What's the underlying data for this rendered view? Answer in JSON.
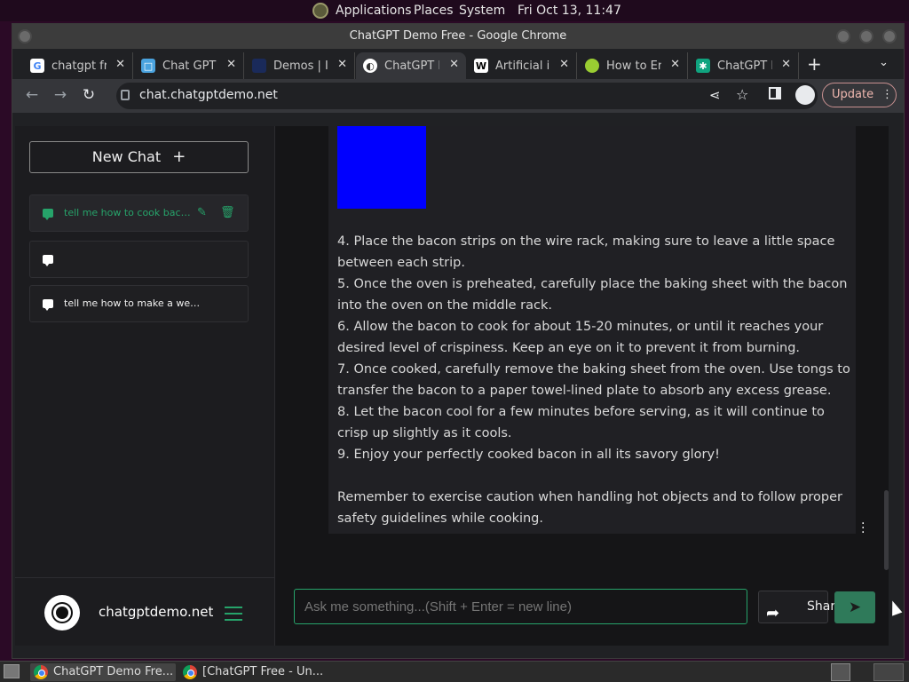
{
  "desktop": {
    "menu": [
      "Applications",
      "Places",
      "System"
    ],
    "clock": "Fri Oct 13, 11:47"
  },
  "window": {
    "title": "ChatGPT Demo Free - Google Chrome"
  },
  "tabs": [
    {
      "label": "chatgpt fre",
      "icon": "google-icon",
      "color": "#ffffff"
    },
    {
      "label": "Chat GPT C",
      "icon": "chat-icon",
      "color": "#4aa3df"
    },
    {
      "label": "Demos | In",
      "icon": "demos-icon",
      "color": "#1a2a5a"
    },
    {
      "label": "ChatGPT D",
      "icon": "chatgptdemo-icon",
      "color": "#ffffff"
    },
    {
      "label": "Artificial i",
      "icon": "wikipedia-icon",
      "color": "#ffffff"
    },
    {
      "label": "How to En",
      "icon": "howto-icon",
      "color": "#9acd32"
    },
    {
      "label": "ChatGPT F",
      "icon": "openai-icon",
      "color": "#10a37f"
    }
  ],
  "toolbar": {
    "url": "chat.chatgptdemo.net",
    "update_label": "Update"
  },
  "sidebar": {
    "new_chat_label": "New Chat",
    "chats": [
      {
        "label": "tell me how to cook bacon"
      },
      {
        "label": ""
      },
      {
        "label": "tell me how to make a website but..."
      }
    ],
    "site_name": "chatgptdemo.net"
  },
  "message": {
    "lines": [
      "4. Place the bacon strips on the wire rack, making sure to leave a little space between each strip.",
      "5. Once the oven is preheated, carefully place the baking sheet with the bacon into the oven on the middle rack.",
      "6. Allow the bacon to cook for about 15-20 minutes, or until it reaches your desired level of crispiness. Keep an eye on it to prevent it from burning.",
      "7. Once cooked, carefully remove the baking sheet from the oven. Use tongs to transfer the bacon to a paper towel-lined plate to absorb any excess grease.",
      "8. Let the bacon cool for a few minutes before serving, as it will continue to crisp up slightly as it cools.",
      "9. Enjoy your perfectly cooked bacon in all its savory glory!"
    ],
    "closing": "Remember to exercise caution when handling hot objects and to follow proper safety guidelines while cooking."
  },
  "composer": {
    "placeholder": "Ask me something...(Shift + Enter = new line)",
    "share_label": "Share"
  },
  "taskbar": {
    "items": [
      "ChatGPT Demo Fre...",
      "[ChatGPT Free - Un..."
    ]
  },
  "colors": {
    "accent": "#26a36a",
    "image_block": "#0000ff"
  }
}
